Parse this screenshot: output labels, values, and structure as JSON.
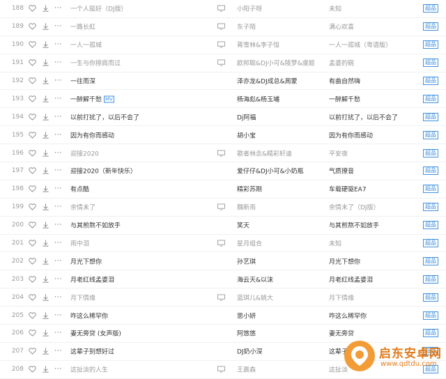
{
  "quality_badge": "超品",
  "mv_label": "MV",
  "songs": [
    {
      "num": "188",
      "title": "一个人挺好（DJ版）",
      "artist": "小阳子呀",
      "album": "未知",
      "dim": true
    },
    {
      "num": "189",
      "title": "一路长虹",
      "artist": "东子陌",
      "album": "满心欢喜",
      "dim": true
    },
    {
      "num": "190",
      "title": "一人一孤城",
      "artist": "蒋雪林&李子恒",
      "album": "一人一孤城（粤语版）",
      "dim": true
    },
    {
      "num": "191",
      "title": "一生与你擦肩而过",
      "artist": "欧邦聪&DJ小可&陵梦&虞姬",
      "album": "孟婆的碗",
      "dim": true
    },
    {
      "num": "192",
      "title": "一往而深",
      "artist": "泽亦龙&DJ成总&周蒙",
      "album": "有曲自然嗨",
      "dim": false
    },
    {
      "num": "193",
      "title": "一醉解千愁",
      "artist": "杨海彪&杨玉埔",
      "album": "一醉解千愁",
      "dim": false,
      "mv": true
    },
    {
      "num": "194",
      "title": "以前打扰了，以后不会了",
      "artist": "Dj阿福",
      "album": "以前打扰了，以后不会了",
      "dim": false
    },
    {
      "num": "195",
      "title": "因为有你而感动",
      "artist": "胡小宝",
      "album": "因为有你而感动",
      "dim": false
    },
    {
      "num": "196",
      "title": "迎接2020",
      "artist": "歌者林念&精彩轩迪",
      "album": "平安夜",
      "dim": true
    },
    {
      "num": "197",
      "title": "迎接2020（新年快乐）",
      "artist": "爱仔仔&DJ小可&小奶瓶",
      "album": "气质撩音",
      "dim": false
    },
    {
      "num": "198",
      "title": "有点酷",
      "artist": "精彩苏刚",
      "album": "车载硬驱EA7",
      "dim": false
    },
    {
      "num": "199",
      "title": "余情未了",
      "artist": "魏新雨",
      "album": "余情未了（DJ版）",
      "dim": true
    },
    {
      "num": "200",
      "title": "与其煎熬不如放手",
      "artist": "笑天",
      "album": "与其煎熬不如放手",
      "dim": false
    },
    {
      "num": "201",
      "title": "雨中泪",
      "artist": "星月组合",
      "album": "未知",
      "dim": true
    },
    {
      "num": "202",
      "title": "月光下想你",
      "artist": "孙艺琪",
      "album": "月光下想你",
      "dim": false
    },
    {
      "num": "203",
      "title": "月老红线孟婆泪",
      "artist": "海云天&以沫",
      "album": "月老红线孟婆泪",
      "dim": false
    },
    {
      "num": "204",
      "title": "月下情缘",
      "artist": "蓝琪儿&姚大",
      "album": "月下情缘",
      "dim": true
    },
    {
      "num": "205",
      "title": "咋这么稀罕你",
      "artist": "思小妍",
      "album": "咋这么稀罕你",
      "dim": false
    },
    {
      "num": "206",
      "title": "妻无旁贷 (女声版)",
      "artist": "阿悠悠",
      "album": "妻无旁贷",
      "dim": false
    },
    {
      "num": "207",
      "title": "这辈子别想好过",
      "artist": "DJ奶小深",
      "album": "这辈子别想好过",
      "dim": false
    },
    {
      "num": "208",
      "title": "这扯淡的人生",
      "artist": "王晨森",
      "album": "这扯淡",
      "dim": true
    }
  ],
  "watermark": {
    "name": "启东安卓网",
    "url": "www.qdtdu.com"
  }
}
